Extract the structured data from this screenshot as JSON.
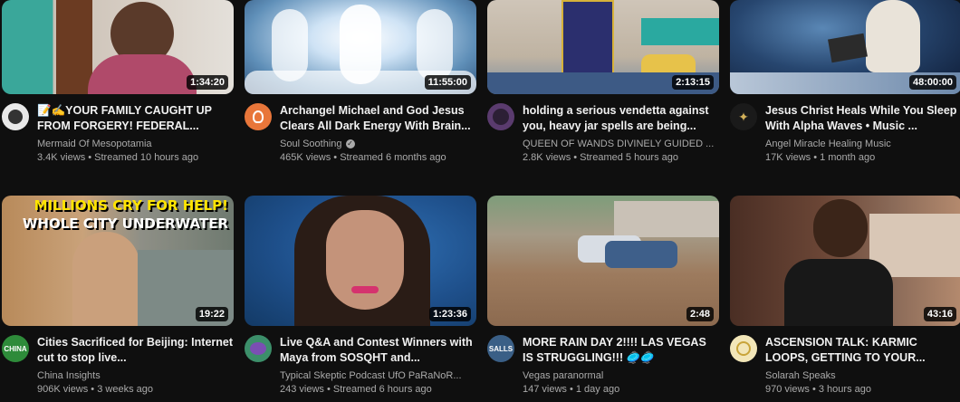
{
  "videos": [
    {
      "duration": "1:34:20",
      "title": "📝✍️YOUR FAMILY CAUGHT UP FROM FORGERY! FEDERAL...",
      "channel": "Mermaid Of Mesopotamia",
      "verified": false,
      "stats": "3.4K views • Streamed 10 hours ago",
      "avatar_color": "#d9d9d9"
    },
    {
      "duration": "11:55:00",
      "title": "Archangel Michael and God Jesus Clears All Dark Energy With Brain...",
      "channel": "Soul Soothing",
      "verified": true,
      "stats": "465K views • Streamed 6 months ago",
      "avatar_color": "#e8763a"
    },
    {
      "duration": "2:13:15",
      "title": "holding a serious vendetta against you, heavy jar spells are being...",
      "channel": "QUEEN OF WANDS DIVINELY GUIDED ...",
      "verified": false,
      "stats": "2.8K views • Streamed 5 hours ago",
      "avatar_color": "#5a3b6e"
    },
    {
      "duration": "48:00:00",
      "title": "Jesus Christ Heals While You Sleep With Alpha Waves • Music ...",
      "channel": "Angel Miracle Healing Music",
      "verified": false,
      "stats": "17K views • 1 month ago",
      "avatar_color": "#1a1a1a"
    },
    {
      "duration": "19:22",
      "title": "Cities Sacrificed for Beijing: Internet cut to stop live...",
      "channel": "China Insights",
      "verified": false,
      "stats": "906K views • 3 weeks ago",
      "avatar_color": "#2e8b3a",
      "avatar_text": "CHINA",
      "thumb_text_1": "MILLIONS CRY FOR HELP!",
      "thumb_text_2": "WHOLE CITY UNDERWATER"
    },
    {
      "duration": "1:23:36",
      "title": "Live Q&A and Contest Winners with Maya from SOSQHT and...",
      "channel": "Typical Skeptic Podcast UfO PaRaNoR...",
      "verified": false,
      "stats": "243 views • Streamed 6 hours ago",
      "avatar_color": "#3c8f6a"
    },
    {
      "duration": "2:48",
      "title": "MORE RAIN DAY 2!!!! LAS VEGAS IS STRUGGLING!!! 🥏🥏",
      "channel": "Vegas paranormal",
      "verified": false,
      "stats": "147 views • 1 day ago",
      "avatar_color": "#3a5f86",
      "avatar_text": "SALLS"
    },
    {
      "duration": "43:16",
      "title": "ASCENSION TALK: KARMIC LOOPS, GETTING TO YOUR...",
      "channel": "Solarah Speaks",
      "verified": false,
      "stats": "970 views • 3 hours ago",
      "avatar_color": "#f2e6b8"
    }
  ]
}
